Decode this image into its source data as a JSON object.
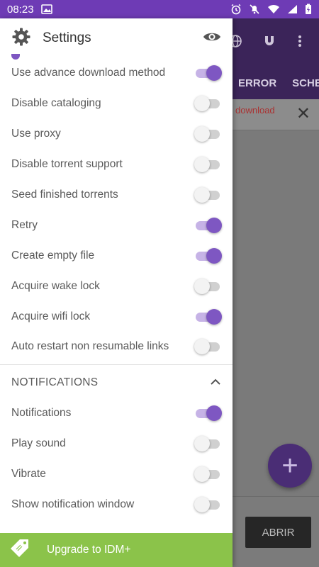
{
  "status_bar": {
    "time": "08:23"
  },
  "background_app": {
    "tabs": [
      "ERROR",
      "SCHE"
    ],
    "banner_text": "download",
    "open_button": "ABRIR"
  },
  "drawer": {
    "title": "Settings",
    "settings": [
      {
        "label": "Use advance download method",
        "on": true
      },
      {
        "label": "Disable cataloging",
        "on": false
      },
      {
        "label": "Use proxy",
        "on": false
      },
      {
        "label": "Disable torrent support",
        "on": false
      },
      {
        "label": "Seed finished torrents",
        "on": false
      },
      {
        "label": "Retry",
        "on": true
      },
      {
        "label": "Create empty file",
        "on": true
      },
      {
        "label": "Acquire wake lock",
        "on": false
      },
      {
        "label": "Acquire wifi lock",
        "on": true
      },
      {
        "label": "Auto restart non resumable links",
        "on": false
      }
    ],
    "notifications_section": {
      "header": "NOTIFICATIONS",
      "items": [
        {
          "label": "Notifications",
          "on": true
        },
        {
          "label": "Play sound",
          "on": false
        },
        {
          "label": "Vibrate",
          "on": false
        },
        {
          "label": "Show notification window",
          "on": false
        }
      ]
    },
    "upgrade_label": "Upgrade to IDM+"
  },
  "colors": {
    "accent": "#7e57c2",
    "status_bar": "#6e3bb5",
    "upgrade": "#8bc34a"
  }
}
